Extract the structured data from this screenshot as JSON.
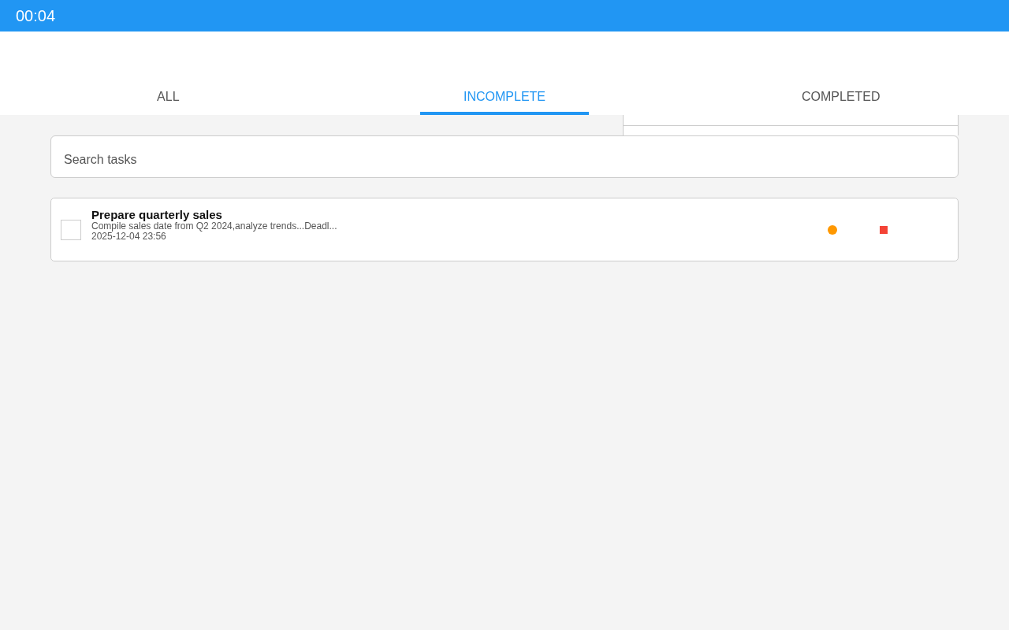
{
  "status_bar": {
    "time": "00:04"
  },
  "tabs": [
    {
      "label": "ALL",
      "selected": false
    },
    {
      "label": "INCOMPLETE",
      "selected": true
    },
    {
      "label": "COMPLETED",
      "selected": false
    }
  ],
  "search": {
    "placeholder": "Search tasks"
  },
  "tasks": [
    {
      "title": "Prepare quarterly sales",
      "description": "Compile sales date from Q2 2024,analyze trends...Deadl...",
      "date": "2025-12-04 23:56",
      "checked": false,
      "priority": {
        "color": "#ff9800"
      },
      "flag": {
        "color": "#f44336"
      }
    }
  ]
}
